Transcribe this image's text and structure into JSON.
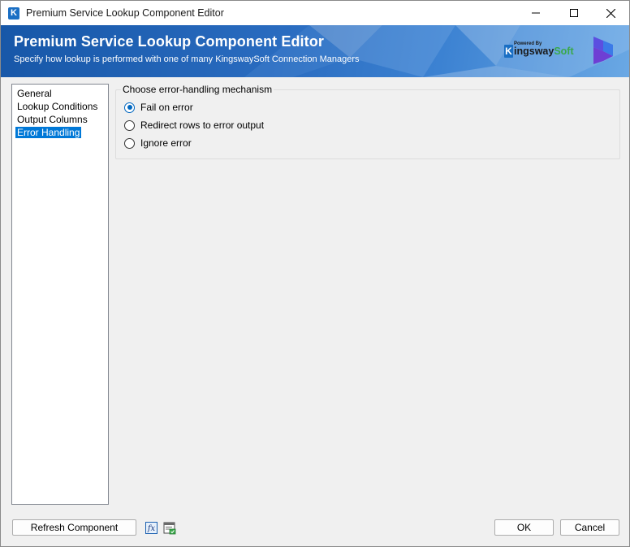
{
  "window": {
    "title": "Premium Service Lookup Component Editor",
    "controls": {
      "minimize": "minimize-icon",
      "maximize": "maximize-icon",
      "close": "close-icon"
    }
  },
  "banner": {
    "title": "Premium Service Lookup Component Editor",
    "subtitle": "Specify how lookup is performed with one of many KingswaySoft Connection Managers",
    "logo_powered_by": "Powered By",
    "logo_k": "K",
    "logo_name_main": "ingsway",
    "logo_name_accent": "Soft"
  },
  "nav": {
    "items": [
      {
        "label": "General",
        "selected": false
      },
      {
        "label": "Lookup Conditions",
        "selected": false
      },
      {
        "label": "Output Columns",
        "selected": false
      },
      {
        "label": "Error Handling",
        "selected": true
      }
    ]
  },
  "error_handling": {
    "legend": "Choose error-handling mechanism",
    "options": [
      {
        "label": "Fail on error",
        "checked": true
      },
      {
        "label": "Redirect rows to error output",
        "checked": false
      },
      {
        "label": "Ignore error",
        "checked": false
      }
    ]
  },
  "footer": {
    "refresh_label": "Refresh Component",
    "fx_label": "fx",
    "ok_label": "OK",
    "cancel_label": "Cancel"
  },
  "colors": {
    "accent": "#0078d7",
    "banner_start": "#1757a8",
    "banner_end": "#6aa8e4",
    "logo_accent": "#3aa84a"
  }
}
